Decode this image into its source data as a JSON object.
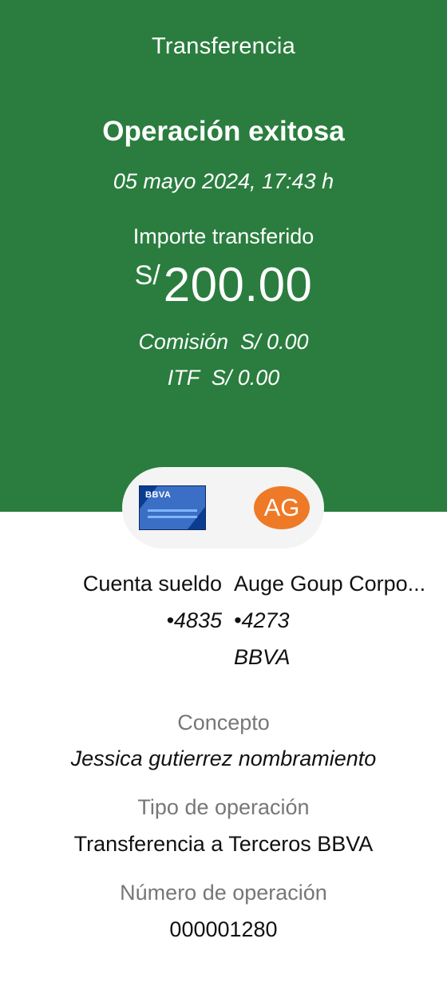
{
  "header": {
    "title": "Transferencia",
    "status": "Operación exitosa",
    "datetime": "05 mayo 2024,  17:43 h",
    "amount_label": "Importe transferido",
    "currency": "S/",
    "amount": "200.00",
    "commission": "Comisión  S/ 0.00",
    "itf": "ITF  S/ 0.00"
  },
  "accounts": {
    "origin_icon": "bbva-card-icon",
    "origin_card_brand": "BBVA",
    "origin_name": "Cuenta sueldo",
    "origin_number": "•4835",
    "dest_avatar": "AG",
    "dest_avatar_color": "#ee7a27",
    "dest_name": "Auge Goup Corpo...",
    "dest_number": "•4273",
    "dest_bank": "BBVA"
  },
  "details": {
    "concept_label": "Concepto",
    "concept_value": "Jessica gutierrez nombramiento",
    "type_label": "Tipo de operación",
    "type_value": "Transferencia a Terceros BBVA",
    "number_label": "Número de operación",
    "number_value": "000001280"
  },
  "colors": {
    "header_bg": "#2a7d3e",
    "bbva_blue": "#0b3c8f"
  }
}
